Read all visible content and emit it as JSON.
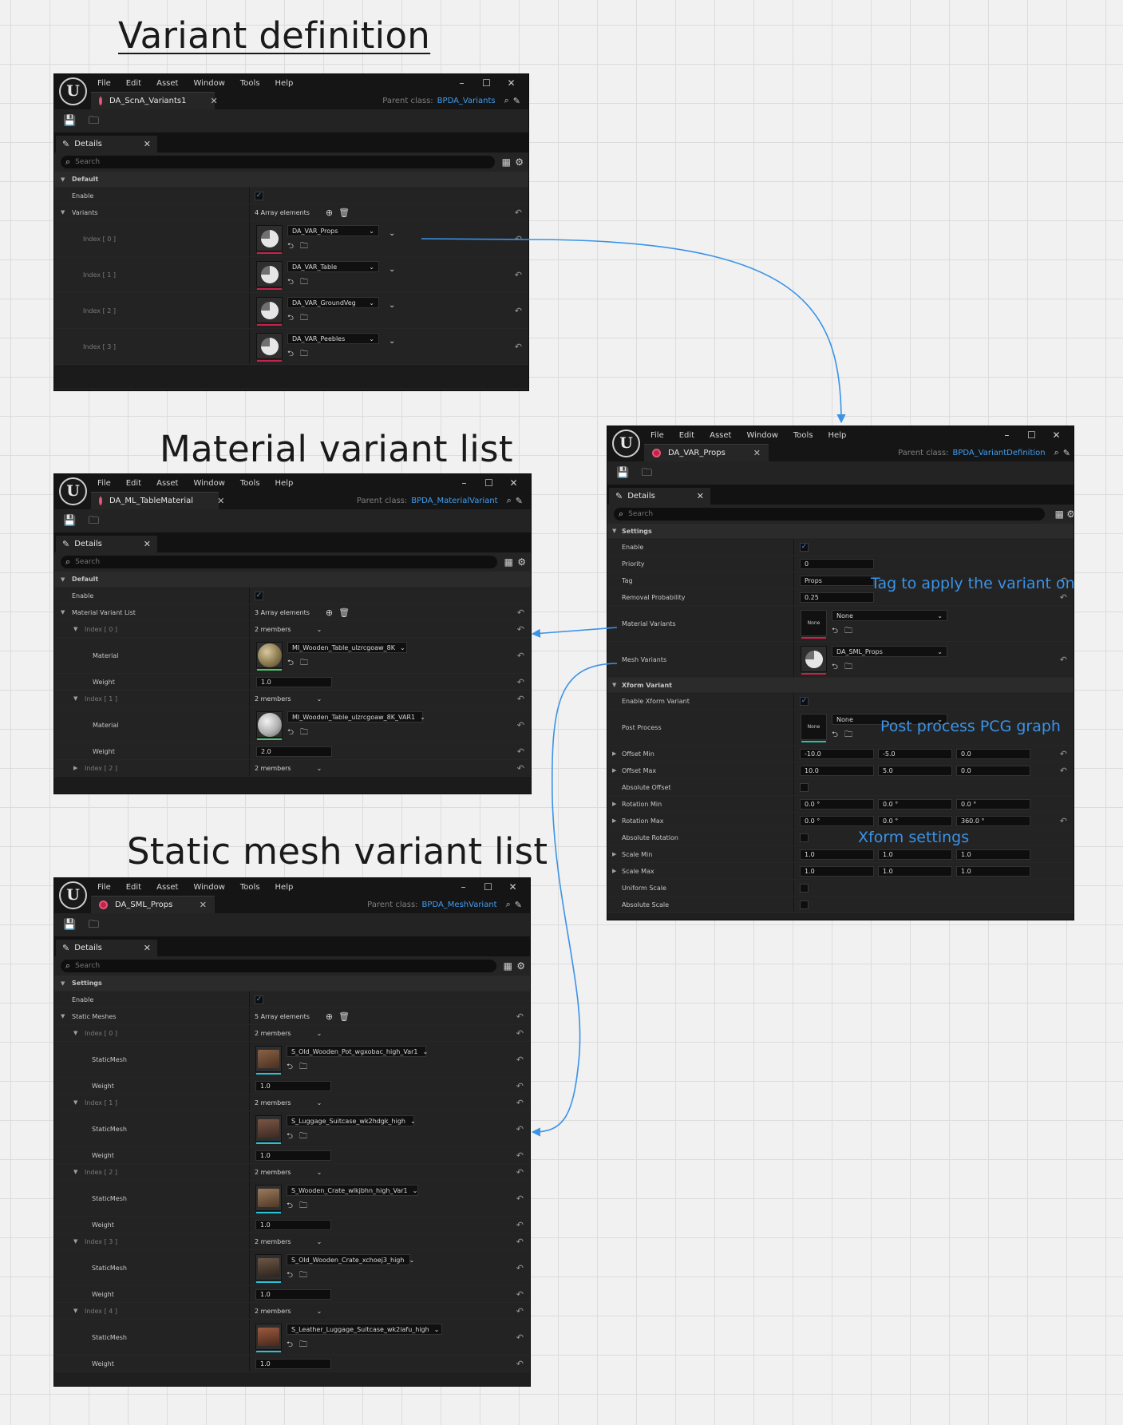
{
  "titles": {
    "variant_definition": "Variant definition",
    "material_list": "Material variant list",
    "static_mesh_list": "Static mesh variant list"
  },
  "annotations": {
    "tag": "Tag to apply the variant on",
    "post_process": "Post process PCG graph",
    "xform": "Xform settings"
  },
  "colors": {
    "link_blue": "#3f9ef2",
    "asset_red": "#c8214a",
    "arrow_blue": "#3a93e8"
  },
  "icons": {
    "logo": "unreal-logo",
    "save": "save-icon",
    "browse": "browse-in-content-icon",
    "search": "search-icon",
    "edit": "pencil-icon",
    "reset": "reset-arrow-icon"
  },
  "menus": [
    "File",
    "Edit",
    "Asset",
    "Window",
    "Tools",
    "Help"
  ],
  "common": {
    "details": "Details",
    "search_placeholder": "Search",
    "parent_label": "Parent class:",
    "enable": "Enable",
    "weight": "Weight",
    "material": "Material",
    "static_mesh": "StaticMesh",
    "members": "2 members"
  },
  "win1": {
    "tab": "DA_ScnA_Variants1",
    "parent": "BPDA_Variants",
    "category": "Default",
    "variants_label": "Variants",
    "variants_count": "4 Array elements",
    "items": [
      {
        "index": "Index [ 0 ]",
        "asset": "DA_VAR_Props"
      },
      {
        "index": "Index [ 1 ]",
        "asset": "DA_VAR_Table"
      },
      {
        "index": "Index [ 2 ]",
        "asset": "DA_VAR_GroundVeg"
      },
      {
        "index": "Index [ 3 ]",
        "asset": "DA_VAR_Peebles"
      }
    ]
  },
  "win2": {
    "tab": "DA_ML_TableMaterial",
    "parent": "BPDA_MaterialVariant",
    "category": "Default",
    "list_label": "Material Variant List",
    "list_count": "3 Array elements",
    "items": [
      {
        "index": "Index [ 0 ]",
        "asset": "MI_Wooden_Table_ulzrcgoaw_8K",
        "weight": "1.0"
      },
      {
        "index": "Index [ 1 ]",
        "asset": "MI_Wooden_Table_ulzrcgoaw_8K_VAR1",
        "weight": "2.0"
      }
    ],
    "index2": "Index [ 2 ]"
  },
  "win3": {
    "tab": "DA_SML_Props",
    "parent": "BPDA_MeshVariant",
    "category": "Settings",
    "list_label": "Static Meshes",
    "list_count": "5 Array elements",
    "items": [
      {
        "index": "Index [ 0 ]",
        "asset": "S_Old_Wooden_Pot_wgxobac_high_Var1",
        "weight": "1.0"
      },
      {
        "index": "Index [ 1 ]",
        "asset": "S_Luggage_Suitcase_wk2hdgk_high",
        "weight": "1.0"
      },
      {
        "index": "Index [ 2 ]",
        "asset": "S_Wooden_Crate_wlkjbhn_high_Var1",
        "weight": "1.0"
      },
      {
        "index": "Index [ 3 ]",
        "asset": "S_Old_Wooden_Crate_xchoej3_high",
        "weight": "1.0"
      },
      {
        "index": "Index [ 4 ]",
        "asset": "S_Leather_Luggage_Suitcase_wk2iafu_high",
        "weight": "1.0"
      }
    ]
  },
  "win4": {
    "tab": "DA_VAR_Props",
    "parent": "BPDA_VariantDefinition",
    "settings": {
      "category": "Settings",
      "enable": "Enable",
      "priority_label": "Priority",
      "priority": "0",
      "tag_label": "Tag",
      "tag": "Props",
      "removal_label": "Removal Probability",
      "removal": "0.25",
      "material_label": "Material Variants",
      "material_value": "None",
      "none_thumb": "None",
      "mesh_label": "Mesh Variants",
      "mesh_value": "DA_SML_Props"
    },
    "xform": {
      "category": "Xform Variant",
      "enable_label": "Enable Xform Variant",
      "post_label": "Post Process",
      "post_value": "None",
      "offset_min_label": "Offset Min",
      "offset_min": [
        "-10.0",
        "-5.0",
        "0.0"
      ],
      "offset_max_label": "Offset Max",
      "offset_max": [
        "10.0",
        "5.0",
        "0.0"
      ],
      "abs_offset": "Absolute Offset",
      "rot_min_label": "Rotation Min",
      "rot_min": [
        "0.0 °",
        "0.0 °",
        "0.0 °"
      ],
      "rot_max_label": "Rotation Max",
      "rot_max": [
        "0.0 °",
        "0.0 °",
        "360.0 °"
      ],
      "abs_rot": "Absolute Rotation",
      "scale_min_label": "Scale Min",
      "scale_min": [
        "1.0",
        "1.0",
        "1.0"
      ],
      "scale_max_label": "Scale Max",
      "scale_max": [
        "1.0",
        "1.0",
        "1.0"
      ],
      "uniform": "Uniform Scale",
      "abs_scale": "Absolute Scale"
    }
  }
}
